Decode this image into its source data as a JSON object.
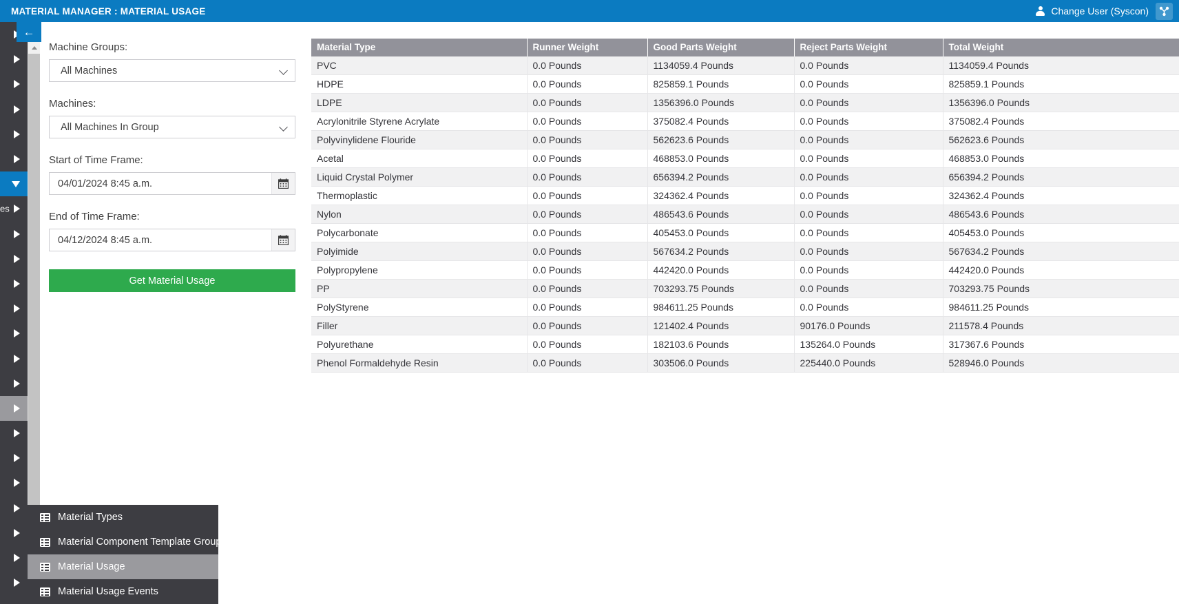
{
  "topbar": {
    "title": "MATERIAL MANAGER : MATERIAL USAGE",
    "change_user_label": "Change User (Syscon)",
    "person_icon": "person-icon",
    "brand_icon": "syscon-brand-icon",
    "background_color": "#0b7bc1"
  },
  "collapse_button": {
    "glyph": "←",
    "name": "collapse-sidebar-icon"
  },
  "rail": {
    "background_color": "#3d3d42",
    "active_color": "#0b7bc1",
    "selected_color": "#9a9a9e",
    "items": [
      {
        "label": "",
        "state": "normal",
        "caret": "right"
      },
      {
        "label": "",
        "state": "normal",
        "caret": "right"
      },
      {
        "label": "",
        "state": "normal",
        "caret": "right"
      },
      {
        "label": "",
        "state": "normal",
        "caret": "right"
      },
      {
        "label": "",
        "state": "normal",
        "caret": "right"
      },
      {
        "label": "",
        "state": "normal",
        "caret": "right"
      },
      {
        "label": "",
        "state": "active",
        "caret": "down"
      },
      {
        "label": "es",
        "state": "normal",
        "caret": "right"
      },
      {
        "label": "",
        "state": "normal",
        "caret": "right"
      },
      {
        "label": "",
        "state": "normal",
        "caret": "right"
      },
      {
        "label": "",
        "state": "normal",
        "caret": "right"
      },
      {
        "label": "",
        "state": "normal",
        "caret": "right"
      },
      {
        "label": "",
        "state": "normal",
        "caret": "right"
      },
      {
        "label": "",
        "state": "normal",
        "caret": "right"
      },
      {
        "label": "",
        "state": "normal",
        "caret": "right"
      },
      {
        "label": "",
        "state": "selected",
        "caret": "right"
      },
      {
        "label": "",
        "state": "normal",
        "caret": "right"
      },
      {
        "label": "",
        "state": "normal",
        "caret": "right"
      },
      {
        "label": "",
        "state": "normal",
        "caret": "right"
      },
      {
        "label": "",
        "state": "normal",
        "caret": "right"
      },
      {
        "label": "",
        "state": "normal",
        "caret": "right"
      },
      {
        "label": "",
        "state": "normal",
        "caret": "right"
      },
      {
        "label": "",
        "state": "normal",
        "caret": "right"
      }
    ]
  },
  "form": {
    "machine_groups_label": "Machine Groups:",
    "machine_groups_value": "All Machines",
    "machines_label": "Machines:",
    "machines_value": "All Machines In Group",
    "start_label": "Start of Time Frame:",
    "start_value": "04/01/2024 8:45 a.m.",
    "end_label": "End of Time Frame:",
    "end_value": "04/12/2024 8:45 a.m.",
    "submit_label": "Get Material Usage",
    "submit_color": "#2eaa4d",
    "calendar_icon": "calendar-icon"
  },
  "flyout": {
    "background_color": "#3d3d42",
    "selected_color": "#9a9a9e",
    "items": [
      {
        "label": "Material Types",
        "selected": false
      },
      {
        "label": "Material Component Template Groups",
        "selected": false
      },
      {
        "label": "Material Usage",
        "selected": true
      },
      {
        "label": "Material Usage Events",
        "selected": false
      }
    ]
  },
  "table": {
    "header_color": "#92929a",
    "columns": [
      "Material Type",
      "Runner Weight",
      "Good Parts Weight",
      "Reject Parts Weight",
      "Total Weight"
    ],
    "rows": [
      [
        "PVC",
        "0.0 Pounds",
        "1134059.4 Pounds",
        "0.0 Pounds",
        "1134059.4 Pounds"
      ],
      [
        "HDPE",
        "0.0 Pounds",
        "825859.1 Pounds",
        "0.0 Pounds",
        "825859.1 Pounds"
      ],
      [
        "LDPE",
        "0.0 Pounds",
        "1356396.0 Pounds",
        "0.0 Pounds",
        "1356396.0 Pounds"
      ],
      [
        "Acrylonitrile Styrene Acrylate",
        "0.0 Pounds",
        "375082.4 Pounds",
        "0.0 Pounds",
        "375082.4 Pounds"
      ],
      [
        "Polyvinylidene Flouride",
        "0.0 Pounds",
        "562623.6 Pounds",
        "0.0 Pounds",
        "562623.6 Pounds"
      ],
      [
        "Acetal",
        "0.0 Pounds",
        "468853.0 Pounds",
        "0.0 Pounds",
        "468853.0 Pounds"
      ],
      [
        "Liquid Crystal Polymer",
        "0.0 Pounds",
        "656394.2 Pounds",
        "0.0 Pounds",
        "656394.2 Pounds"
      ],
      [
        "Thermoplastic",
        "0.0 Pounds",
        "324362.4 Pounds",
        "0.0 Pounds",
        "324362.4 Pounds"
      ],
      [
        "Nylon",
        "0.0 Pounds",
        "486543.6 Pounds",
        "0.0 Pounds",
        "486543.6 Pounds"
      ],
      [
        "Polycarbonate",
        "0.0 Pounds",
        "405453.0 Pounds",
        "0.0 Pounds",
        "405453.0 Pounds"
      ],
      [
        "Polyimide",
        "0.0 Pounds",
        "567634.2 Pounds",
        "0.0 Pounds",
        "567634.2 Pounds"
      ],
      [
        "Polypropylene",
        "0.0 Pounds",
        "442420.0 Pounds",
        "0.0 Pounds",
        "442420.0 Pounds"
      ],
      [
        "PP",
        "0.0 Pounds",
        "703293.75 Pounds",
        "0.0 Pounds",
        "703293.75 Pounds"
      ],
      [
        "PolyStyrene",
        "0.0 Pounds",
        "984611.25 Pounds",
        "0.0 Pounds",
        "984611.25 Pounds"
      ],
      [
        "Filler",
        "0.0 Pounds",
        "121402.4 Pounds",
        "90176.0 Pounds",
        "211578.4 Pounds"
      ],
      [
        "Polyurethane",
        "0.0 Pounds",
        "182103.6 Pounds",
        "135264.0 Pounds",
        "317367.6 Pounds"
      ],
      [
        "Phenol Formaldehyde Resin",
        "0.0 Pounds",
        "303506.0 Pounds",
        "225440.0 Pounds",
        "528946.0 Pounds"
      ]
    ]
  }
}
